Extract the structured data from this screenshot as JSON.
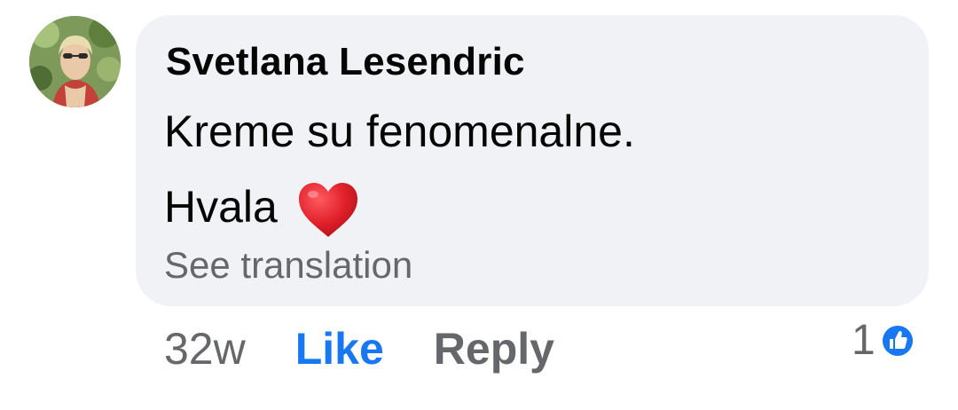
{
  "comment": {
    "author": "Svetlana Lesendric",
    "text_line1": "Kreme su fenomenalne.",
    "text_line2": "Hvala",
    "emoji": "heart-emoji",
    "see_translation": "See translation"
  },
  "actions": {
    "time": "32w",
    "like_label": "Like",
    "reply_label": "Reply"
  },
  "reactions": {
    "count": "1",
    "icon": "like-reaction-icon"
  },
  "colors": {
    "bubble": "#f0f2f5",
    "like_blue": "#1877f2",
    "secondary_text": "#65676b",
    "heart_red": "#e0202a"
  }
}
